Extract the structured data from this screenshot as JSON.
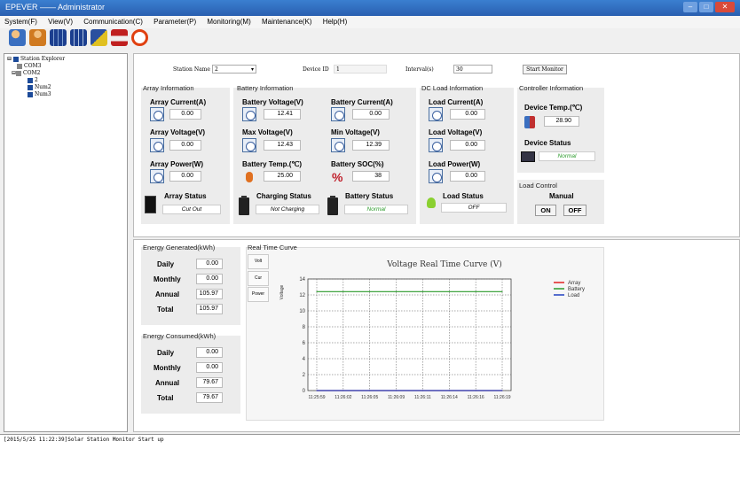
{
  "window": {
    "title": "EPEVER —— Administrator"
  },
  "menu": [
    "System(F)",
    "View(V)",
    "Communication(C)",
    "Parameter(P)",
    "Monitoring(M)",
    "Maintenance(K)",
    "Help(H)"
  ],
  "toolbar": {
    "icons": [
      "users-icon",
      "user-icon",
      "solar-panel-icon",
      "solar-panel-icon",
      "settings-panel-icon",
      "printer-icon",
      "power-icon"
    ]
  },
  "tree": {
    "root": "Station Explorer",
    "com3": "COM3",
    "com2": "COM2",
    "n2": "2",
    "num2": "Num2",
    "num3": "Num3"
  },
  "station": {
    "name_label": "Station Name",
    "name_value": "2",
    "device_label": "Device ID",
    "device_value": "1",
    "interval_label": "Interval(s)",
    "interval_value": "30",
    "start_button": "Start Monitor"
  },
  "array": {
    "title": "Array Information",
    "current_label": "Array Current(A)",
    "current": "0.00",
    "voltage_label": "Array Voltage(V)",
    "voltage": "0.00",
    "power_label": "Array Power(W)",
    "power": "0.00",
    "status_label": "Array Status",
    "status": "Cut Out"
  },
  "battery": {
    "title": "Battery Information",
    "voltage_label": "Battery Voltage(V)",
    "voltage": "12.41",
    "current_label": "Battery Current(A)",
    "current": "0.00",
    "maxv_label": "Max Voltage(V)",
    "maxv": "12.43",
    "minv_label": "Min Voltage(V)",
    "minv": "12.39",
    "temp_label": "Battery Temp.(℃)",
    "temp": "25.00",
    "soc_label": "Battery SOC(%)",
    "soc": "38",
    "charging_label": "Charging Status",
    "charging": "Not Charging",
    "status_label": "Battery Status",
    "status": "Normal"
  },
  "load": {
    "title": "DC Load Information",
    "current_label": "Load Current(A)",
    "current": "0.00",
    "voltage_label": "Load Voltage(V)",
    "voltage": "0.00",
    "power_label": "Load Power(W)",
    "power": "0.00",
    "status_label": "Load Status",
    "status": "OFF"
  },
  "controller": {
    "title": "Controller Information",
    "temp_label": "Device Temp.(℃)",
    "temp": "28.90",
    "status_label": "Device Status",
    "status": "Normal"
  },
  "load_control": {
    "title": "Load Control",
    "mode": "Manual",
    "on": "ON",
    "off": "OFF"
  },
  "energy_generated": {
    "title": "Energy Generated(kWh)",
    "rows": [
      {
        "label": "Daily",
        "value": "0.00"
      },
      {
        "label": "Monthly",
        "value": "0.00"
      },
      {
        "label": "Annual",
        "value": "105.97"
      },
      {
        "label": "Total",
        "value": "105.97"
      }
    ]
  },
  "energy_consumed": {
    "title": "Energy Consumed(kWh)",
    "rows": [
      {
        "label": "Daily",
        "value": "0.00"
      },
      {
        "label": "Monthly",
        "value": "0.00"
      },
      {
        "label": "Annual",
        "value": "79.67"
      },
      {
        "label": "Total",
        "value": "79.67"
      }
    ]
  },
  "realtime": {
    "title": "Real Time Curve",
    "tabs": [
      "Volt",
      "Cur",
      "Power"
    ]
  },
  "chart_data": {
    "type": "line",
    "title": "Voltage Real Time Curve (V)",
    "ylabel": "Voltage",
    "xlabel": "",
    "categories": [
      "11:25:59",
      "11:26:02",
      "11:26:05",
      "11:26:09",
      "11:26:11",
      "11:26:14",
      "11:26:16",
      "11:26:19"
    ],
    "ylim": [
      0,
      14
    ],
    "yticks": [
      0,
      2,
      4,
      6,
      8,
      10,
      12,
      14
    ],
    "grid": true,
    "legend": "top-right",
    "series": [
      {
        "name": "Array",
        "color": "#e02020",
        "values": [
          0,
          0,
          0,
          0,
          0,
          0,
          0,
          0
        ]
      },
      {
        "name": "Battery",
        "color": "#2a9a2a",
        "values": [
          12.41,
          12.41,
          12.41,
          12.41,
          12.41,
          12.41,
          12.41,
          12.41
        ]
      },
      {
        "name": "Load",
        "color": "#2040c0",
        "values": [
          0,
          0,
          0,
          0,
          0,
          0,
          0,
          0
        ]
      }
    ]
  },
  "log": {
    "line": "[2015/5/25 11:22:39]Solar Station Monitor Start up"
  },
  "colors": {
    "titlebar": "#2a5fb0",
    "status_normal": "#2a9a2a"
  }
}
